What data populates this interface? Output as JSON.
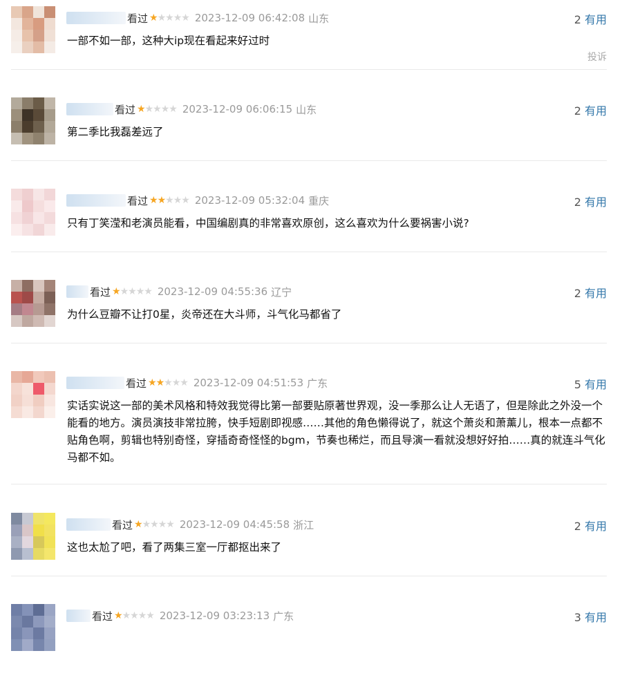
{
  "report_label": "投诉",
  "useful_label": "有用",
  "comments": [
    {
      "status": "看过",
      "stars": 1,
      "time": "2023-12-09 06:42:08",
      "location": "山东",
      "useful": "2",
      "text": "一部不如一部，这种大ip现在看起来好过时"
    },
    {
      "status": "看过",
      "stars": 1,
      "time": "2023-12-09 06:06:15",
      "location": "山东",
      "useful": "2",
      "text": "第二季比我磊差远了"
    },
    {
      "status": "看过",
      "stars": 2,
      "time": "2023-12-09 05:32:04",
      "location": "重庆",
      "useful": "2",
      "text": "只有丁笑滢和老演员能看，中国编剧真的非常喜欢原创，这么喜欢为什么要祸害小说?"
    },
    {
      "status": "看过",
      "stars": 1,
      "time": "2023-12-09 04:55:36",
      "location": "辽宁",
      "useful": "2",
      "text": "为什么豆瓣不让打0星，炎帝还在大斗师，斗气化马都省了"
    },
    {
      "status": "看过",
      "stars": 2,
      "time": "2023-12-09 04:51:53",
      "location": "广东",
      "useful": "5",
      "text": "实话实说这一部的美术风格和特效我觉得比第一部要贴原著世界观，没一季那么让人无语了，但是除此之外没一个能看的地方。演员演技非常拉胯，快手短剧即视感……其他的角色懒得说了，就这个萧炎和萧薰儿，根本一点都不贴角色啊，剪辑也特别奇怪，穿插奇奇怪怪的bgm，节奏也稀烂，而且导演一看就没想好好拍……真的就连斗气化马都不如。"
    },
    {
      "status": "看过",
      "stars": 1,
      "time": "2023-12-09 04:45:58",
      "location": "浙江",
      "useful": "2",
      "text": "这也太尬了吧，看了两集三室一厅都抠出来了"
    },
    {
      "status": "看过",
      "stars": 1,
      "time": "2023-12-09 03:23:13",
      "location": "广东",
      "useful": "3",
      "text": ""
    }
  ]
}
